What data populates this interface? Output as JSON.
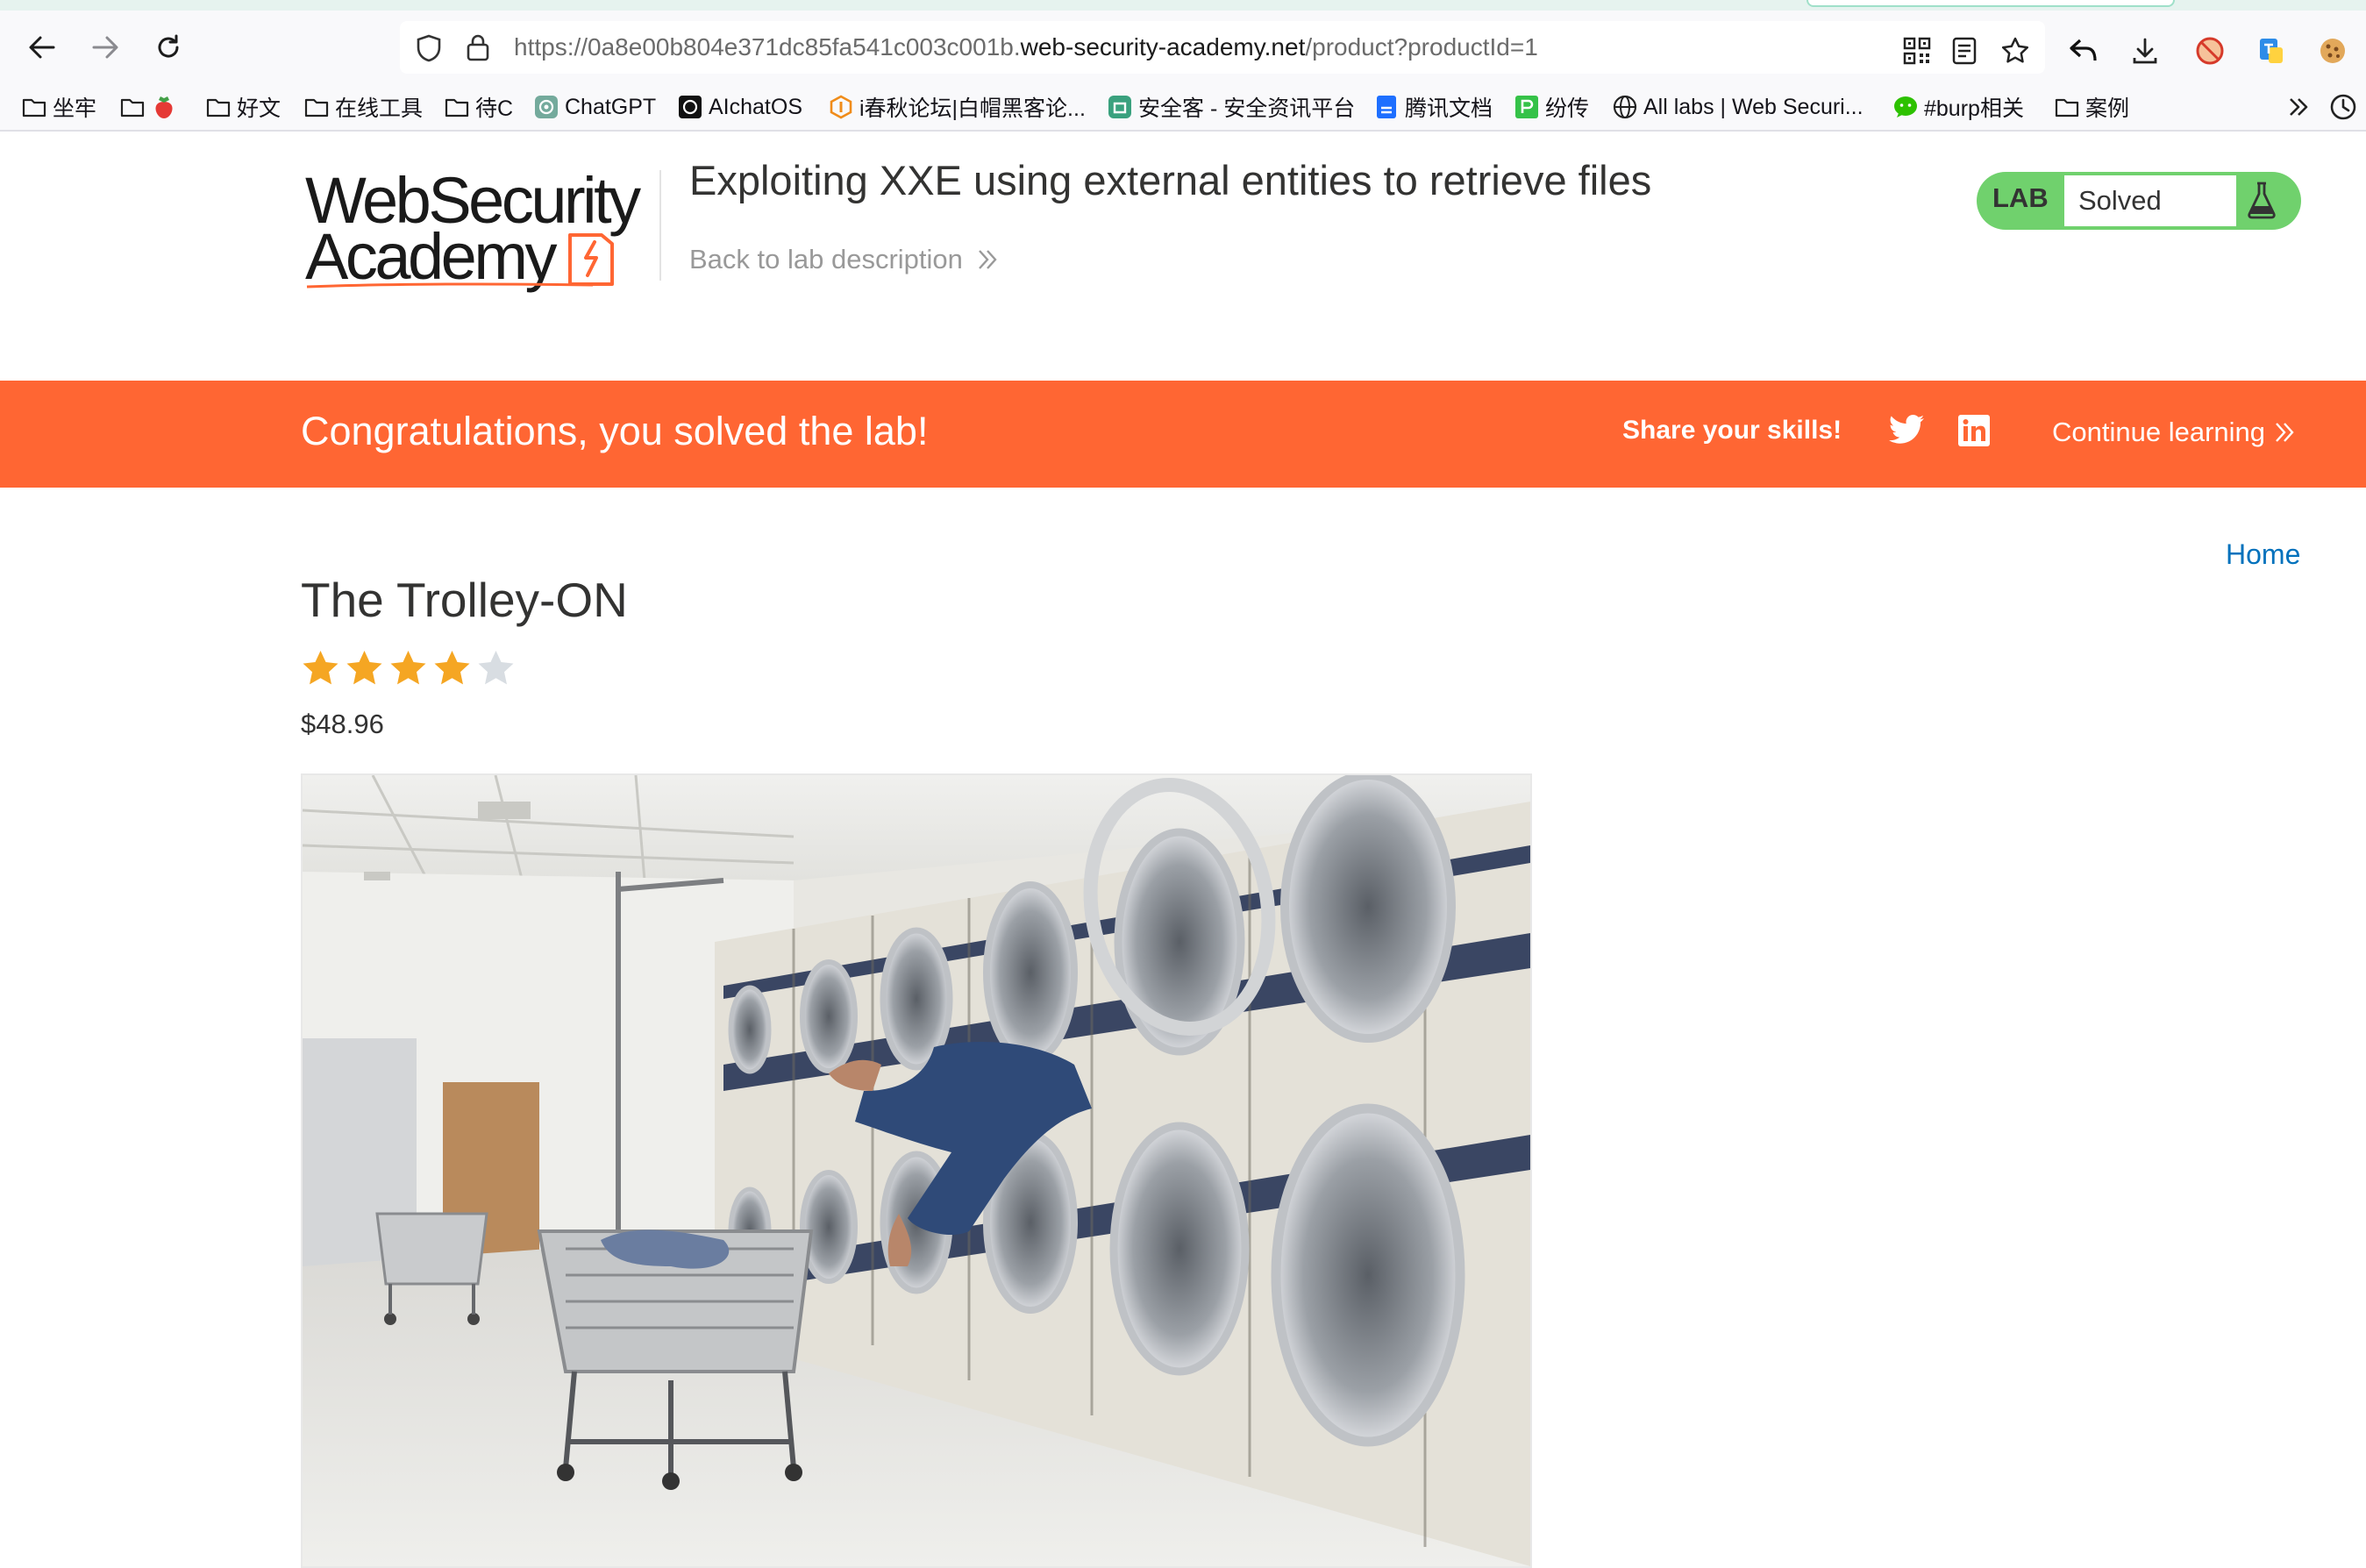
{
  "browser": {
    "url_prefix": "https://0a8e00b804e371dc85fa541c003c001b.",
    "url_domain": "web-security-academy.net",
    "url_path": "/product?productId=1",
    "bookmarks": [
      {
        "label": "坐牢",
        "icon": "folder-icon"
      },
      {
        "label": "",
        "icon": "folder-icon"
      },
      {
        "label": "好文",
        "icon": "folder-icon"
      },
      {
        "label": "在线工具",
        "icon": "folder-icon"
      },
      {
        "label": "待C",
        "icon": "folder-icon"
      },
      {
        "label": "ChatGPT",
        "icon": "chatgpt-icon"
      },
      {
        "label": "AIchatOS",
        "icon": "aichatos-icon"
      },
      {
        "label": "i春秋论坛|白帽黑客论...",
        "icon": "ichunqiu-icon"
      },
      {
        "label": "安全客 - 安全资讯平台",
        "icon": "anquanke-icon"
      },
      {
        "label": "腾讯文档",
        "icon": "tencent-docs-icon"
      },
      {
        "label": "纷传",
        "icon": "fenchuan-icon"
      },
      {
        "label": "All labs | Web Securi...",
        "icon": "globe-icon"
      },
      {
        "label": "#burp相关",
        "icon": "wechat-icon"
      },
      {
        "label": "案例",
        "icon": "folder-icon"
      }
    ]
  },
  "header": {
    "logo_line1": "WebSecurity",
    "logo_line2": "Academy",
    "lab_title": "Exploiting XXE using external entities to retrieve files",
    "back_link": "Back to lab description",
    "lab_status_label": "LAB",
    "lab_status_value": "Solved"
  },
  "banner": {
    "message": "Congratulations, you solved the lab!",
    "share_label": "Share your skills!",
    "continue_label": "Continue learning"
  },
  "nav": {
    "home": "Home"
  },
  "product": {
    "name": "The Trolley-ON",
    "rating": 4,
    "rating_max": 5,
    "price": "$48.96"
  },
  "colors": {
    "banner": "#ff6633",
    "lab_status": "#70d16d",
    "link": "#0071bc",
    "star_filled": "#f5a623",
    "star_empty": "#d8dde2"
  }
}
